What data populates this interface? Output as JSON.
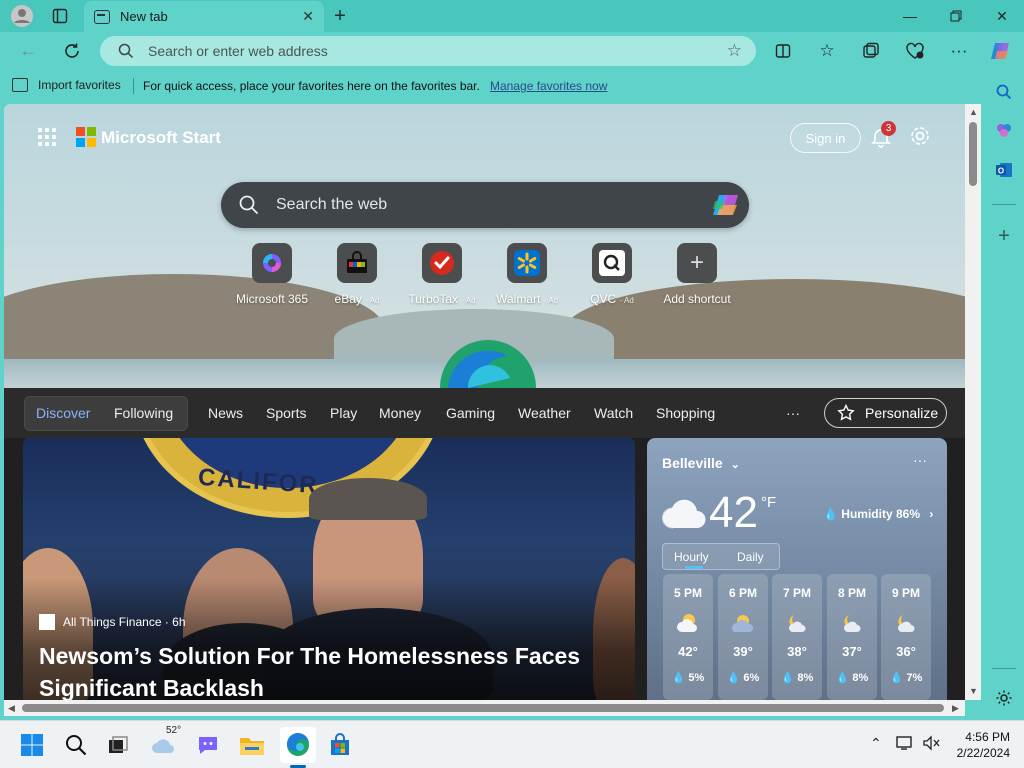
{
  "tab": {
    "title": "New tab"
  },
  "addressbar": {
    "placeholder": "Search or enter web address"
  },
  "favorites_bar": {
    "import_label": "Import favorites",
    "hint": "For quick access, place your favorites here on the favorites bar.",
    "manage_link": "Manage favorites now"
  },
  "start": {
    "brand": "Microsoft Start",
    "signin": "Sign in",
    "notification_count": "3",
    "search_placeholder": "Search the web",
    "shortcuts": [
      {
        "label": "Microsoft 365",
        "ad": ""
      },
      {
        "label": "eBay",
        "ad": "· Ad"
      },
      {
        "label": "TurboTax",
        "ad": "· Ad"
      },
      {
        "label": "Walmart",
        "ad": "· Ad"
      },
      {
        "label": "QVC",
        "ad": "· Ad"
      },
      {
        "label": "Add shortcut",
        "ad": ""
      }
    ]
  },
  "feed_nav": {
    "items": [
      "Discover",
      "Following",
      "News",
      "Sports",
      "Play",
      "Money",
      "Gaming",
      "Weather",
      "Watch",
      "Shopping"
    ],
    "more": "···",
    "personalize": "Personalize"
  },
  "news": {
    "seal_text": "CALIFOR",
    "source": "All Things Finance · 6h",
    "headline": "Newsom’s Solution For The Homelessness Faces Significant Backlash"
  },
  "weather": {
    "city": "Belleville",
    "more": "···",
    "temp": "42",
    "unit": "°F",
    "humidity": "Humidity 86%",
    "tabs": [
      "Hourly",
      "Daily"
    ],
    "hours": [
      {
        "time": "5 PM",
        "temp": "42°",
        "rain": "5%"
      },
      {
        "time": "6 PM",
        "temp": "39°",
        "rain": "6%"
      },
      {
        "time": "7 PM",
        "temp": "38°",
        "rain": "8%"
      },
      {
        "time": "8 PM",
        "temp": "37°",
        "rain": "8%"
      },
      {
        "time": "9 PM",
        "temp": "36°",
        "rain": "7%"
      }
    ]
  },
  "taskbar": {
    "weather_temp": "52°",
    "time": "4:56 PM",
    "date": "2/22/2024"
  },
  "colors": {
    "browser_frame": "#5fd2c9",
    "accent_blue": "#0067c0",
    "badge_red": "#d13438"
  }
}
